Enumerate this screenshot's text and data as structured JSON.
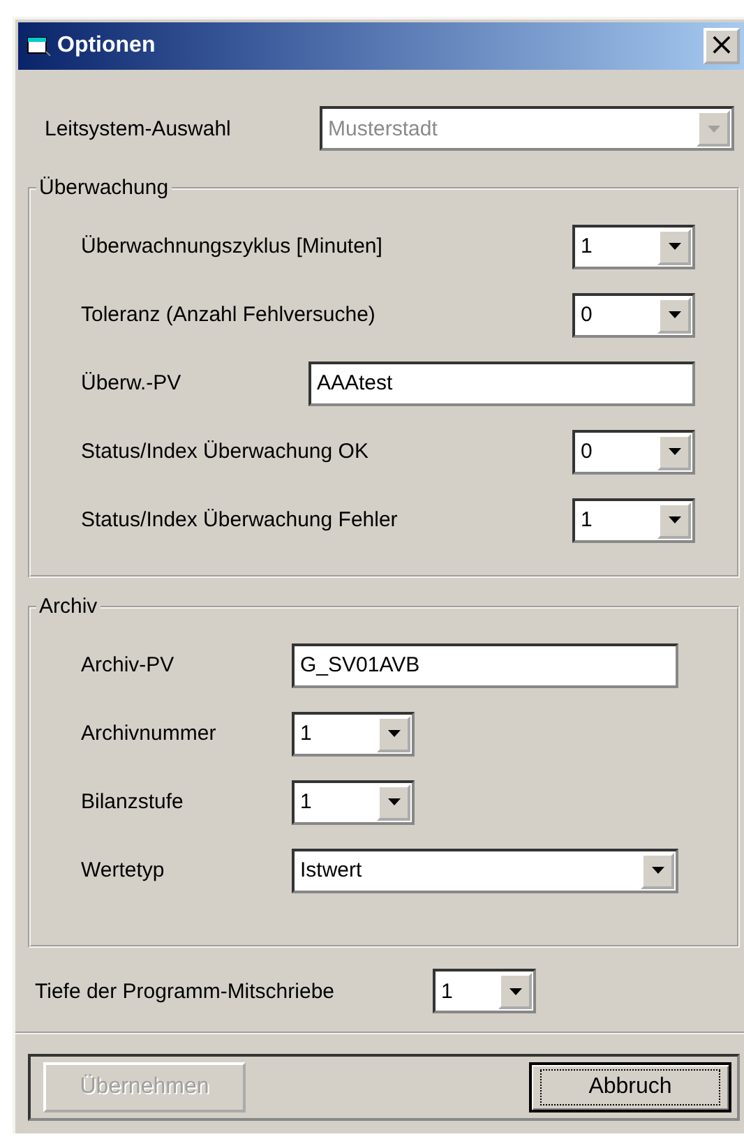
{
  "window": {
    "title": "Optionen",
    "close": "×"
  },
  "system": {
    "label": "Leitsystem-Auswahl",
    "value": "Musterstadt",
    "disabled": true
  },
  "groups": [
    {
      "title": "Überwachung",
      "rows": [
        {
          "label": "Überwachnungszyklus [Minuten]",
          "kind": "dropdown",
          "value": "1"
        },
        {
          "label": "Toleranz (Anzahl Fehlversuche)",
          "kind": "dropdown",
          "value": "0"
        },
        {
          "label": "Überw.-PV",
          "kind": "text",
          "value": "AAAtest"
        },
        {
          "label": "Status/Index Überwachung OK",
          "kind": "dropdown",
          "value": "0"
        },
        {
          "label": "Status/Index Überwachung Fehler",
          "kind": "dropdown",
          "value": "1"
        }
      ]
    },
    {
      "title": "Archiv",
      "rows": [
        {
          "label": "Archiv-PV",
          "kind": "text",
          "value": "G_SV01AVB"
        },
        {
          "label": "Archivnummer",
          "kind": "dropdown",
          "value": "1"
        },
        {
          "label": "Bilanzstufe",
          "kind": "dropdown",
          "value": "1"
        },
        {
          "label": "Wertetyp",
          "kind": "wide",
          "value": "Istwert"
        }
      ]
    }
  ],
  "depth": {
    "label": "Tiefe der Programm-Mitschriebe",
    "value": "1"
  },
  "buttons": [
    {
      "label": "Übernehmen",
      "disabled": true,
      "focused": false
    },
    {
      "label": "Abbruch",
      "disabled": false,
      "focused": true
    }
  ]
}
